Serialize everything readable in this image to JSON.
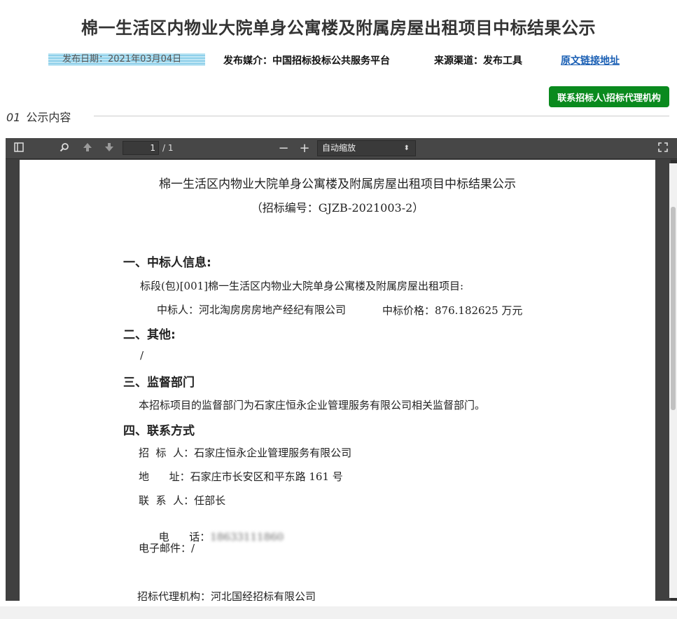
{
  "page": {
    "title": "棉一生活区内物业大院单身公寓楼及附属房屋出租项目中标结果公示",
    "meta": {
      "date": "发布日期：2021年03月04日",
      "media": "发布媒介：中国招标投标公共服务平台",
      "source": "来源渠道：发布工具",
      "link": "原文链接地址"
    },
    "contact_button": "联系招标人\\招标代理机构",
    "section": {
      "num": "01",
      "label": "公示内容"
    }
  },
  "viewer": {
    "page_number": "1",
    "page_total": "/ 1",
    "zoom": "自动缩放",
    "icons": [
      "sidebar-toggle-icon",
      "search-icon",
      "page-up-icon",
      "page-down-icon",
      "zoom-out-icon",
      "zoom-in-icon",
      "fullscreen-icon"
    ]
  },
  "document": {
    "title": "棉一生活区内物业大院单身公寓楼及附属房屋出租项目中标结果公示",
    "subtitle": "（招标编号：GJZB-2021003-2）",
    "s1": {
      "heading": "一、中标人信息:",
      "lot": "标段(包)[001]棉一生活区内物业大院单身公寓楼及附属房屋出租项目:",
      "winner": "中标人：河北淘房房房地产经纪有限公司",
      "price": "中标价格：876.182625 万元"
    },
    "s2": {
      "heading": "二、其他:",
      "content": "/"
    },
    "s3": {
      "heading": "三、监督部门",
      "content": "本招标项目的监督部门为石家庄恒永企业管理服务有限公司相关监督部门。"
    },
    "s4": {
      "heading": "四、联系方式",
      "tenderer": "招  标  人：石家庄恒永企业管理服务有限公司",
      "address": "地      址：石家庄市长安区和平东路 161 号",
      "contact": "联  系  人：任部长",
      "phone_label": "电      话：",
      "phone_value": "18633111860",
      "email": "电子邮件：/"
    },
    "agency": "招标代理机构：河北国经招标有限公司"
  }
}
